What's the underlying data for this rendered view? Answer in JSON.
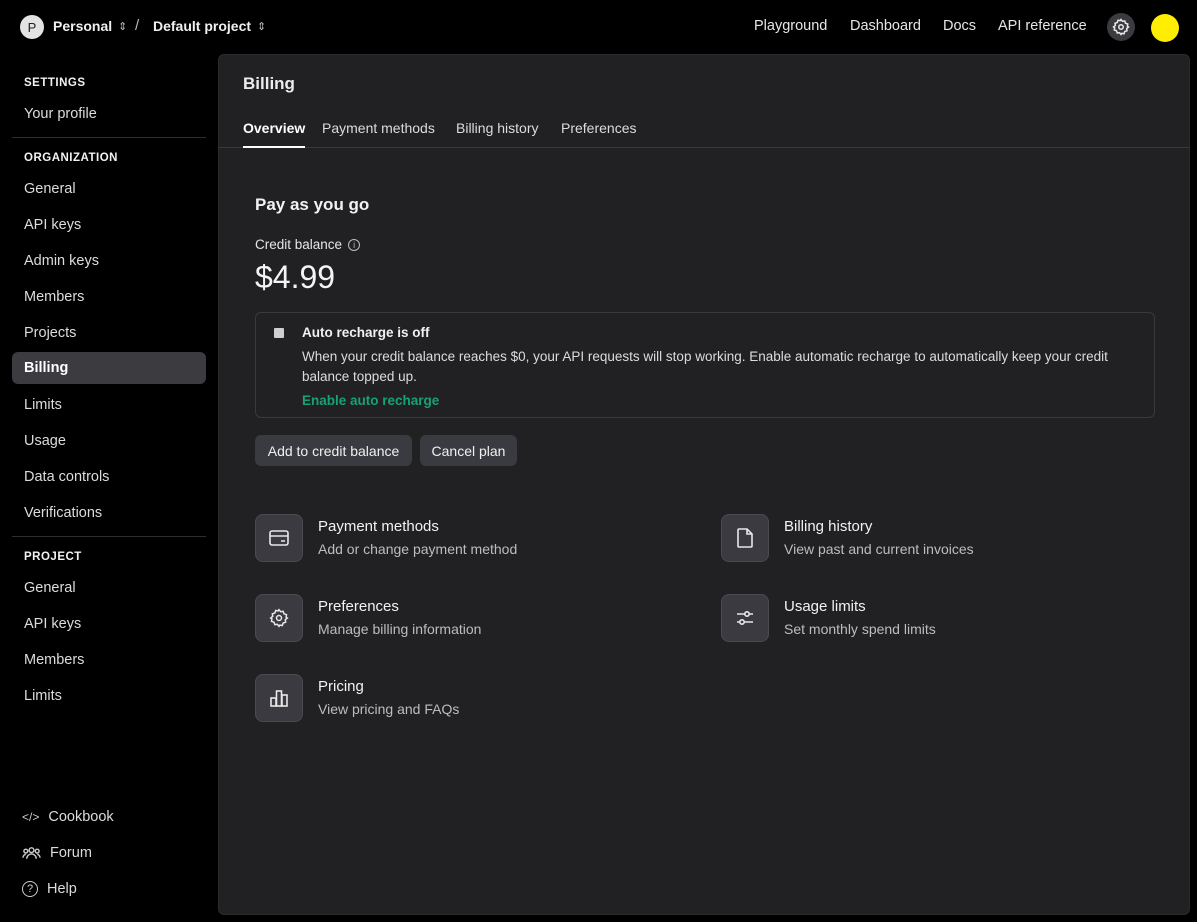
{
  "topbar": {
    "org_initial": "P",
    "org_name": "Personal",
    "separator": "/",
    "project_name": "Default project",
    "links": [
      "Playground",
      "Dashboard",
      "Docs",
      "API reference"
    ]
  },
  "sidebar": {
    "settings_title": "SETTINGS",
    "your_profile": "Your profile",
    "organization_title": "ORGANIZATION",
    "org_items": [
      "General",
      "API keys",
      "Admin keys",
      "Members",
      "Projects",
      "Billing",
      "Limits",
      "Usage",
      "Data controls",
      "Verifications"
    ],
    "active_item": "Billing",
    "project_title": "PROJECT",
    "project_items": [
      "General",
      "API keys",
      "Members",
      "Limits"
    ],
    "footer": [
      "Cookbook",
      "Forum",
      "Help"
    ]
  },
  "main": {
    "title": "Billing",
    "tabs": [
      "Overview",
      "Payment methods",
      "Billing history",
      "Preferences"
    ],
    "active_tab": "Overview",
    "plan_heading": "Pay as you go",
    "credit_label": "Credit balance",
    "credit_value": "$4.99",
    "recharge": {
      "title": "Auto recharge is off",
      "text": "When your credit balance reaches $0, your API requests will stop working. Enable automatic recharge to automatically keep your credit balance topped up.",
      "link": "Enable auto recharge"
    },
    "buttons": [
      "Add to credit balance",
      "Cancel plan"
    ],
    "cards": [
      {
        "title": "Payment methods",
        "subtitle": "Add or change payment method",
        "icon": "credit-card-icon"
      },
      {
        "title": "Billing history",
        "subtitle": "View past and current invoices",
        "icon": "document-icon"
      },
      {
        "title": "Preferences",
        "subtitle": "Manage billing information",
        "icon": "gear-icon"
      },
      {
        "title": "Usage limits",
        "subtitle": "Set monthly spend limits",
        "icon": "sliders-icon"
      },
      {
        "title": "Pricing",
        "subtitle": "View pricing and FAQs",
        "icon": "bar-chart-icon"
      }
    ]
  },
  "colors": {
    "background": "#000000",
    "panel": "#212123",
    "accent_green": "#16a271",
    "user_avatar": "#ffee00"
  }
}
